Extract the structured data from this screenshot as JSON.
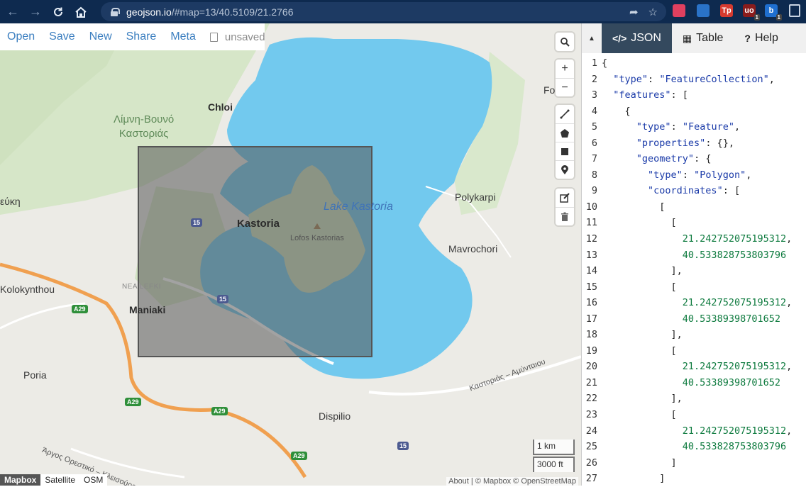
{
  "browser": {
    "url_host": "geojson.io",
    "url_path": "/#map=13/40.5109/21.2766",
    "nav_icons": [
      "back-icon",
      "forward-icon",
      "reload-icon",
      "home-icon"
    ],
    "extensions": [
      {
        "name": "pocket-icon",
        "color": "#e0405f",
        "label": ""
      },
      {
        "name": "ext-blue-icon",
        "color": "#2a73c8",
        "label": ""
      },
      {
        "name": "tp-icon",
        "color": "#d63a2f",
        "label": "Tp"
      },
      {
        "name": "ublock-icon",
        "color": "#8a1c1c",
        "label": "uo",
        "badge": "1"
      },
      {
        "name": "ext-lab-icon",
        "color": "#1f6fd0",
        "label": "b",
        "badge": "1"
      }
    ]
  },
  "menu": {
    "items": [
      "Open",
      "Save",
      "New",
      "Share",
      "Meta"
    ],
    "file_status": "unsaved"
  },
  "map": {
    "labels": {
      "forest": "Λίμνη-Βουνό\nΚαστοριάς",
      "chloi": "Chloi",
      "kastoria": "Kastoria",
      "lake": "Lake Kastoria",
      "lofos": "Lofos Kastorias",
      "polykarpi": "Polykarpi",
      "mavrochori": "Mavrochori",
      "maniaki": "Maniaki",
      "nea_lefki": "NEA LEFKI",
      "kolokynthou": "Kolokynthou",
      "poria": "Poria",
      "dispilio": "Dispilio",
      "fo": "Fo",
      "eukn": "εύκη",
      "road_kastorias": "Καστοριάς – Αμύνταιου",
      "road_argos": "Άργος Ορεστικό – Κλεισούρα"
    },
    "shields": {
      "a29_1": "A29",
      "a29_2": "A29",
      "a29_3": "A29",
      "a29_4": "A29",
      "r15_1": "15",
      "r15_2": "15",
      "r15_3": "15"
    },
    "controls": {
      "search": "search-icon",
      "zoom_in": "+",
      "zoom_out": "−"
    },
    "scale": {
      "km": "1 km",
      "ft": "3000 ft"
    },
    "layers": [
      "Mapbox",
      "Satellite",
      "OSM"
    ],
    "active_layer": "Mapbox",
    "attribution": "About | © Mapbox © OpenStreetMap"
  },
  "pane": {
    "tabs": [
      {
        "icon": "</>",
        "label": "JSON"
      },
      {
        "icon": "▦",
        "label": "Table"
      },
      {
        "icon": "?",
        "label": "Help"
      }
    ],
    "lines": [
      {
        "n": "1",
        "t": "{"
      },
      {
        "n": "2",
        "t": "  \"type\": \"FeatureCollection\","
      },
      {
        "n": "3",
        "t": "  \"features\": ["
      },
      {
        "n": "4",
        "t": "    {"
      },
      {
        "n": "5",
        "t": "      \"type\": \"Feature\","
      },
      {
        "n": "6",
        "t": "      \"properties\": {},"
      },
      {
        "n": "7",
        "t": "      \"geometry\": {"
      },
      {
        "n": "8",
        "t": "        \"type\": \"Polygon\","
      },
      {
        "n": "9",
        "t": "        \"coordinates\": ["
      },
      {
        "n": "10",
        "t": "          ["
      },
      {
        "n": "11",
        "t": "            ["
      },
      {
        "n": "12",
        "t": "              21.242752075195312,"
      },
      {
        "n": "13",
        "t": "              40.533828753803796"
      },
      {
        "n": "14",
        "t": "            ],"
      },
      {
        "n": "15",
        "t": "            ["
      },
      {
        "n": "16",
        "t": "              21.242752075195312,"
      },
      {
        "n": "17",
        "t": "              40.53389398701652"
      },
      {
        "n": "18",
        "t": "            ],"
      },
      {
        "n": "19",
        "t": "            ["
      },
      {
        "n": "20",
        "t": "              21.242752075195312,"
      },
      {
        "n": "21",
        "t": "              40.53389398701652"
      },
      {
        "n": "22",
        "t": "            ],"
      },
      {
        "n": "23",
        "t": "            ["
      },
      {
        "n": "24",
        "t": "              21.242752075195312,"
      },
      {
        "n": "25",
        "t": "              40.533828753803796"
      },
      {
        "n": "26",
        "t": "            ]"
      },
      {
        "n": "27",
        "t": "          ]"
      }
    ]
  }
}
